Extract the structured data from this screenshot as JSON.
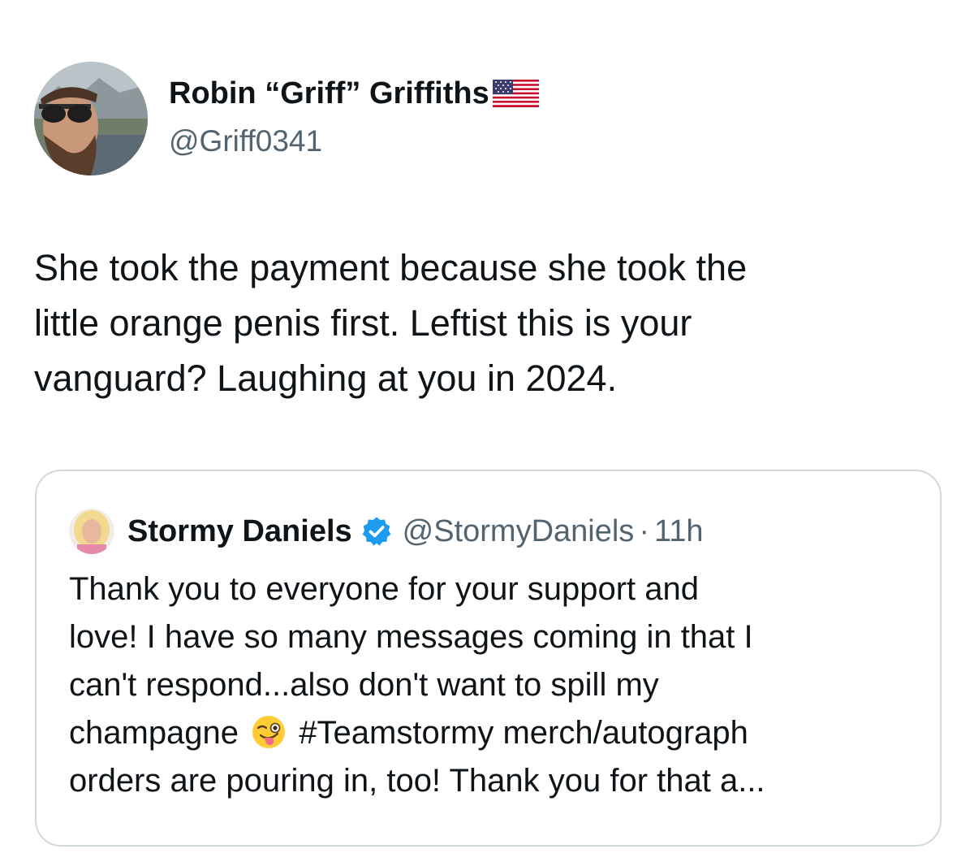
{
  "tweet": {
    "author": {
      "name": "Robin “Griff” Griffiths",
      "handle": "@Griff0341",
      "flag_icon": "us-flag-icon"
    },
    "text_lines": [
      "She took the payment because she took the",
      "little orange penis first. Leftist this is your",
      "vanguard? Laughing at you in 2024."
    ]
  },
  "quoted_tweet": {
    "author": {
      "name": "Stormy Daniels",
      "handle": "@StormyDaniels",
      "separator": "·",
      "time": "11h",
      "verified_icon": "verified-badge-icon"
    },
    "text_lines": [
      "Thank you to everyone for your support and",
      "love! I have so many messages coming in that I",
      "can't respond...also don't want to spill my"
    ],
    "line4_before_emoji": "champagne",
    "emoji_icon": "winking-face-with-tongue-icon",
    "line4_after_emoji": "#Teamstormy merch/autograph",
    "line5": "orders are pouring in, too! Thank you for that a..."
  },
  "colors": {
    "text_primary": "#0f1419",
    "text_secondary": "#536471",
    "border": "#cfd9de",
    "verified_blue": "#1d9bf0"
  }
}
